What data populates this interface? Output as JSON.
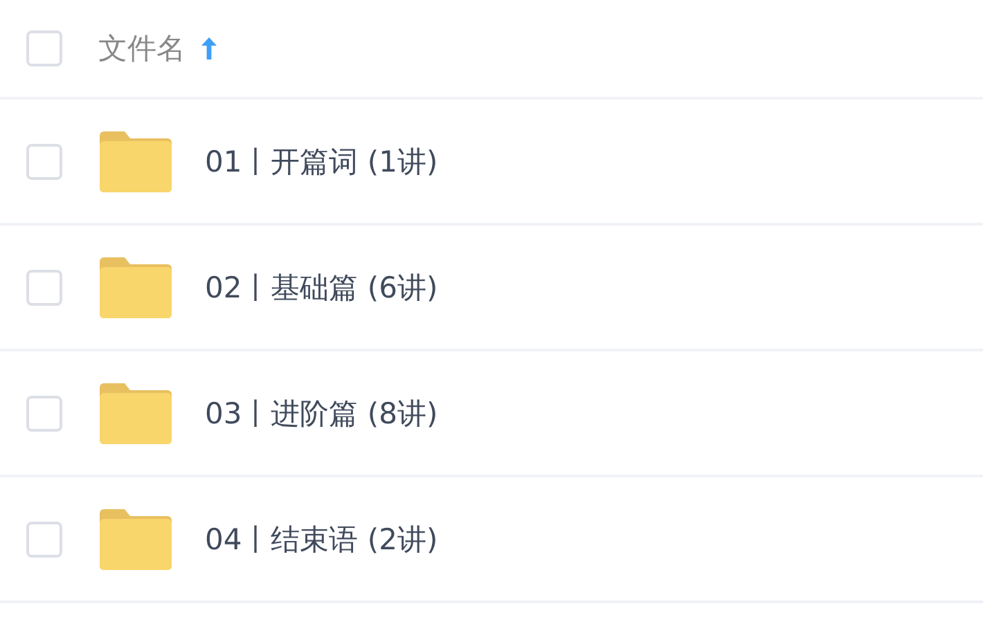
{
  "header": {
    "checked": false,
    "label": "文件名",
    "sorted_ascending": true
  },
  "rows": [
    {
      "name": "01丨开篇词 (1讲)",
      "checked": false
    },
    {
      "name": "02丨基础篇 (6讲)",
      "checked": false
    },
    {
      "name": "03丨进阶篇 (8讲)",
      "checked": false
    },
    {
      "name": "04丨结束语 (2讲)",
      "checked": false
    }
  ]
}
